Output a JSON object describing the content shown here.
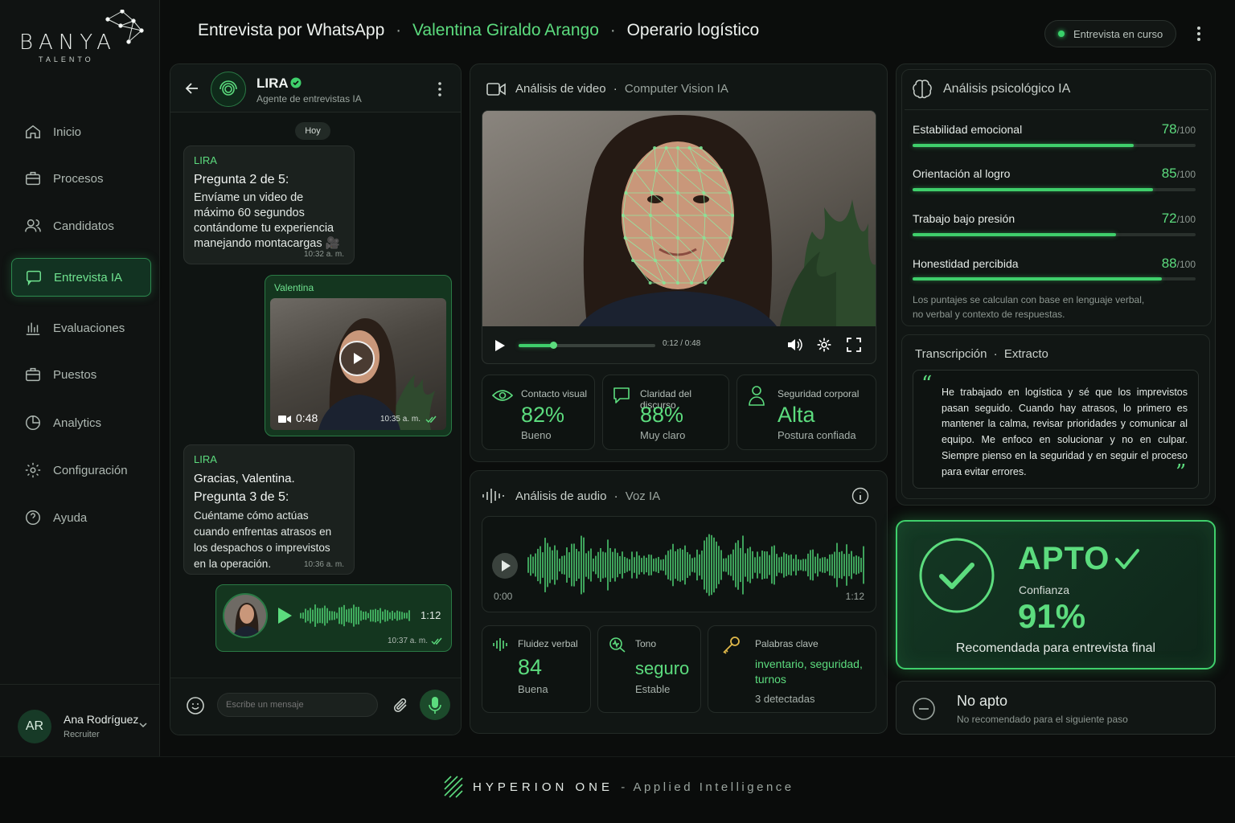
{
  "brand": {
    "name": "BANYA",
    "sub": "TALENTO"
  },
  "sidebar": {
    "items": [
      {
        "label": "Inicio",
        "icon": "home-icon"
      },
      {
        "label": "Procesos",
        "icon": "briefcase-icon"
      },
      {
        "label": "Candidatos",
        "icon": "users-icon"
      },
      {
        "label": "Entrevista IA",
        "icon": "chat-icon",
        "active": true
      },
      {
        "label": "Evaluaciones",
        "icon": "bar-chart-icon"
      },
      {
        "label": "Puestos",
        "icon": "briefcase-icon"
      },
      {
        "label": "Analytics",
        "icon": "pie-chart-icon"
      },
      {
        "label": "Configuración",
        "icon": "gear-icon"
      },
      {
        "label": "Ayuda",
        "icon": "help-icon"
      }
    ],
    "user": {
      "initials": "AR",
      "name": "Ana Rodríguez",
      "role": "Recruiter"
    }
  },
  "header": {
    "title": "Entrevista por WhatsApp",
    "candidate": "Valentina Giraldo Arango",
    "role": "Operario logístico",
    "separator": "·",
    "status": "Entrevista en curso"
  },
  "chat": {
    "agent_name": "LIRA",
    "agent_sub": "Agente de entrevistas IA",
    "day": "Hoy",
    "msg1": {
      "who": "LIRA",
      "question": "Pregunta 2 de 5:",
      "text": "Envíame un video de máximo 60 segundos contándome tu experiencia manejando montacargas 🎥",
      "time": "10:32 a. m."
    },
    "msg2": {
      "who": "Valentina",
      "duration": "0:48",
      "time": "10:35 a. m."
    },
    "msg3": {
      "who": "LIRA",
      "greeting": "Gracias, Valentina.",
      "question": "Pregunta 3 de 5:",
      "text": "Cuéntame cómo actúas cuando enfrentas atrasos en los despachos o imprevistos en la operación.",
      "time": "10:36 a. m."
    },
    "msg4": {
      "duration": "1:12",
      "time": "10:37 a. m."
    },
    "input_placeholder": "Escribe un mensaje"
  },
  "video": {
    "title": "Análisis de video",
    "subtitle": "Computer Vision IA",
    "time": "0:12 / 0:48",
    "progress": 0.25,
    "metrics": [
      {
        "label": "Contacto visual",
        "value": "82%",
        "sub": "Bueno",
        "icon": "eye-icon"
      },
      {
        "label": "Claridad del discurso",
        "value": "88%",
        "sub": "Muy claro",
        "icon": "speech-bubble-icon"
      },
      {
        "label": "Seguridad corporal",
        "value": "Alta",
        "sub": "Postura confiada",
        "icon": "person-icon"
      }
    ]
  },
  "audio": {
    "title": "Análisis de audio",
    "subtitle": "Voz IA",
    "start": "0:00",
    "end": "1:12",
    "metrics": [
      {
        "label": "Fluidez verbal",
        "value": "84",
        "sub": "Buena",
        "icon": "waveform-icon"
      },
      {
        "label": "Tono",
        "value": "seguro",
        "sub": "Estable",
        "icon": "tone-icon"
      },
      {
        "label": "Palabras clave",
        "value": "inventario, seguridad, turnos",
        "sub": "3 detectadas",
        "icon": "key-icon"
      }
    ]
  },
  "psych": {
    "title": "Análisis psicológico IA",
    "scores": [
      {
        "label": "Estabilidad emocional",
        "value": "78",
        "fraction": 0.78
      },
      {
        "label": "Orientación al logro",
        "value": "85",
        "fraction": 0.85
      },
      {
        "label": "Trabajo bajo presión",
        "value": "72",
        "fraction": 0.72
      },
      {
        "label": "Honestidad percibida",
        "value": "88",
        "fraction": 0.88
      }
    ],
    "max": "/100",
    "note": "Los puntajes se calculan con base en lenguaje verbal, no verbal y contexto de respuestas."
  },
  "transcript": {
    "title": "Transcripción",
    "subtitle": "Extracto",
    "text": "He trabajado en logística y sé que los imprevistos pasan seguido. Cuando hay atrasos, lo primero es mantener la calma, revisar prioridades y comunicar al equipo. Me enfoco en solucionar y no en culpar. Siempre pienso en la seguridad y en seguir el proceso para evitar errores."
  },
  "verdict": {
    "label": "APTO",
    "confidence_label": "Confianza",
    "confidence": "91%",
    "recommendation": "Recomendada para entrevista final",
    "alt_label": "No apto",
    "alt_sub": "No recomendado para el siguiente paso"
  },
  "footer": {
    "brand": "HYPERION ONE",
    "tagline": "- Applied Intelligence"
  },
  "colors": {
    "accent": "#5cdc7e",
    "background": "#0b0d0c",
    "panel": "#111614"
  }
}
